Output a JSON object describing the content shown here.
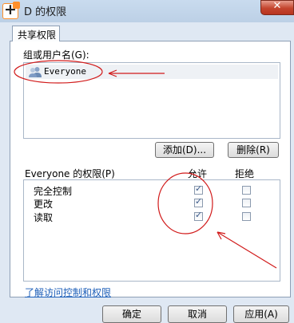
{
  "window": {
    "title": "D 的权限",
    "close_glyph": "✕"
  },
  "tabs": [
    {
      "label": "共享权限"
    }
  ],
  "users_group": {
    "label": "组或用户名(G):",
    "items": [
      {
        "name": "Everyone"
      }
    ],
    "add_button": "添加(D)...",
    "remove_button": "删除(R)"
  },
  "permissions": {
    "label": "Everyone 的权限(P)",
    "allow_header": "允许",
    "deny_header": "拒绝",
    "rows": [
      {
        "name": "完全控制",
        "allow": true,
        "deny": false
      },
      {
        "name": "更改",
        "allow": true,
        "deny": false
      },
      {
        "name": "读取",
        "allow": true,
        "deny": false
      }
    ]
  },
  "link": {
    "text": "了解访问控制和权限"
  },
  "bottom_buttons": [
    "确定",
    "取消",
    "应用(A)"
  ],
  "annotation_color": "#d11a1a",
  "checkbox_mark": "✓"
}
